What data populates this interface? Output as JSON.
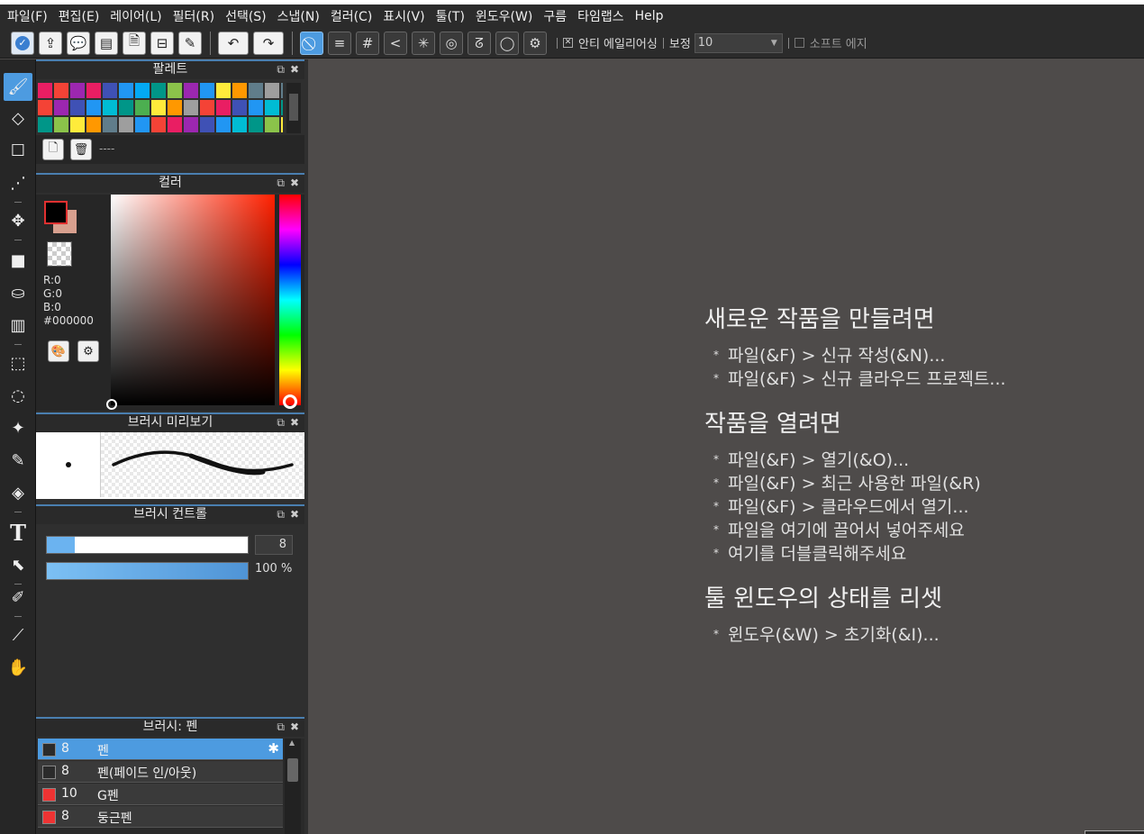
{
  "menu": [
    "파일(F)",
    "편집(E)",
    "레이어(L)",
    "필터(R)",
    "선택(S)",
    "스냅(N)",
    "컬러(C)",
    "표시(V)",
    "툴(T)",
    "윈도우(W)",
    "구름",
    "타임랩스",
    "Help"
  ],
  "toolbar": {
    "antialias_label": "안티 에일리어싱",
    "correction_label": "보정",
    "correction_value": "10",
    "soft_edge_label": "소프트 에지"
  },
  "panels": {
    "palette": {
      "title": "팔레트",
      "set_name": "----"
    },
    "color": {
      "title": "컬러",
      "r": "R:0",
      "g": "G:0",
      "b": "B:0",
      "hex": "#000000"
    },
    "brush_preview": {
      "title": "브러시 미리보기"
    },
    "brush_control": {
      "title": "브러시 컨트롤",
      "size_value": "8",
      "size_fraction": 0.14,
      "opacity": "100 %",
      "opacity_fraction": 1.0
    },
    "brush_list": {
      "title": "브러시: 펜",
      "items": [
        {
          "size": "8",
          "name": "펜",
          "color": "#2b2b2b"
        },
        {
          "size": "8",
          "name": "펜(페이드 인/아웃)",
          "color": "#2b2b2b"
        },
        {
          "size": "10",
          "name": "G펜",
          "color": "#ee3333"
        },
        {
          "size": "8",
          "name": "둥근펜",
          "color": "#ee3333"
        }
      ]
    }
  },
  "palette_colors": [
    "#e91e63",
    "#f44336",
    "#9c27b0",
    "#e91e63",
    "#3f51b5",
    "#2196f3",
    "#03a9f4",
    "#009688",
    "#8bc34a",
    "#9c27b0",
    "#2196f3",
    "#ffeb3b",
    "#ff9800",
    "#607d8b",
    "#9e9e9e",
    "#607d8b",
    "#f44336",
    "#9c27b0",
    "#3f51b5",
    "#2196f3",
    "#00bcd4",
    "#009688",
    "#4caf50",
    "#ffeb3b",
    "#ff9800",
    "#9e9e9e",
    "#f44336",
    "#e91e63",
    "#3f51b5",
    "#2196f3",
    "#00bcd4",
    "#009688",
    "#009688",
    "#8bc34a",
    "#ffeb3b",
    "#ff9800",
    "#607d8b",
    "#9e9e9e",
    "#2196f3",
    "#f44336",
    "#e91e63",
    "#9c27b0",
    "#3f51b5",
    "#2196f3",
    "#00bcd4",
    "#009688",
    "#8bc34a",
    "#ffeb3b"
  ],
  "canvas_help": {
    "new_heading": "새로운 작품을 만들려면",
    "new_items": [
      "파일(&F) > 신규 작성(&N)...",
      "파일(&F) > 신규 클라우드 프로젝트..."
    ],
    "open_heading": "작품을 열려면",
    "open_items": [
      "파일(&F) > 열기(&O)...",
      "파일(&F) > 최근 사용한 파일(&R)",
      "파일(&F) > 클라우드에서 열기...",
      "파일을 여기에 끌어서 넣어주세요",
      "여기를 더블클릭해주세요"
    ],
    "reset_heading": "툴 윈도우의 상태를 리셋",
    "reset_items": [
      "윈도우(&W) > 초기화(&I)..."
    ]
  }
}
